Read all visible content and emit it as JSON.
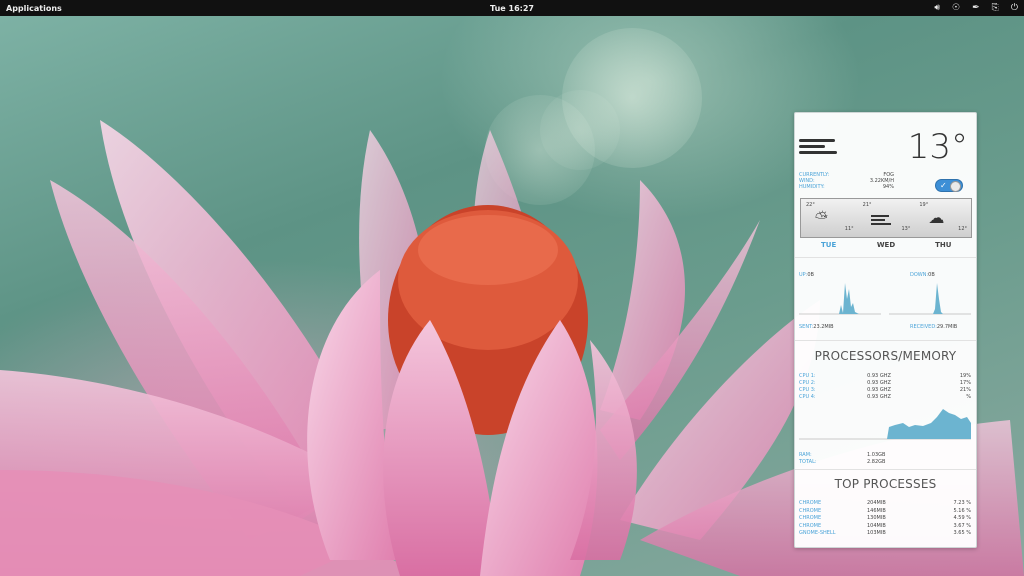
{
  "panel": {
    "applications": "Applications",
    "clock": "Tue 16:27",
    "tray_icons": [
      "volume-icon",
      "headphones-icon",
      "pen-icon",
      "clipboard-icon",
      "power-icon"
    ]
  },
  "weather": {
    "temperature": "13°",
    "current_icon": "fog-icon",
    "stats": [
      {
        "label": "CURRENTLY:",
        "value": "FOG"
      },
      {
        "label": "WIND:",
        "value": "3.22KM/H"
      },
      {
        "label": "HUMIDITY:",
        "value": "94%"
      }
    ],
    "forecast": [
      {
        "day": "TUE",
        "high": "22°",
        "low": "11°",
        "icon": "sun-cloud-icon"
      },
      {
        "day": "WED",
        "high": "21°",
        "low": "13°",
        "icon": "fog-icon"
      },
      {
        "day": "THU",
        "high": "19°",
        "low": "12°",
        "icon": "rain-cloud-icon"
      }
    ]
  },
  "network": {
    "up_label": "UP:",
    "up_value": "0B",
    "down_label": "DOWN:",
    "down_value": "0B",
    "sent_label": "SENT:",
    "sent_value": "23.2MIB",
    "received_label": "RECEIVED:",
    "received_value": "29.7MIB"
  },
  "processors": {
    "title": "PROCESSORS/MEMORY",
    "cpus": [
      {
        "label": "CPU 1:",
        "freq": "0.93 GHZ",
        "pct": "19%"
      },
      {
        "label": "CPU 2:",
        "freq": "0.93 GHZ",
        "pct": "17%"
      },
      {
        "label": "CPU 3:",
        "freq": "0.93 GHZ",
        "pct": "21%"
      },
      {
        "label": "CPU 4:",
        "freq": "0.93 GHZ",
        "pct": "%"
      }
    ],
    "ram_label": "RAM:",
    "ram_value": "1.03GB",
    "total_label": "TOTAL:",
    "total_value": "2.82GB"
  },
  "top_processes": {
    "title": "TOP PROCESSES",
    "rows": [
      {
        "name": "CHROME",
        "mem": "204MIB",
        "cpu": "7.23 %"
      },
      {
        "name": "CHROME",
        "mem": "146MIB",
        "cpu": "5.16 %"
      },
      {
        "name": "CHROME",
        "mem": "130MIB",
        "cpu": "4.59 %"
      },
      {
        "name": "CHROME",
        "mem": "104MIB",
        "cpu": "3.67 %"
      },
      {
        "name": "GNOME-SHELL",
        "mem": "103MIB",
        "cpu": "3.65 %"
      }
    ]
  },
  "colors": {
    "accent": "#4aa3d8",
    "graph": "#6cb4d0",
    "panel": "#111111",
    "toggle": "#3d8fd6"
  }
}
